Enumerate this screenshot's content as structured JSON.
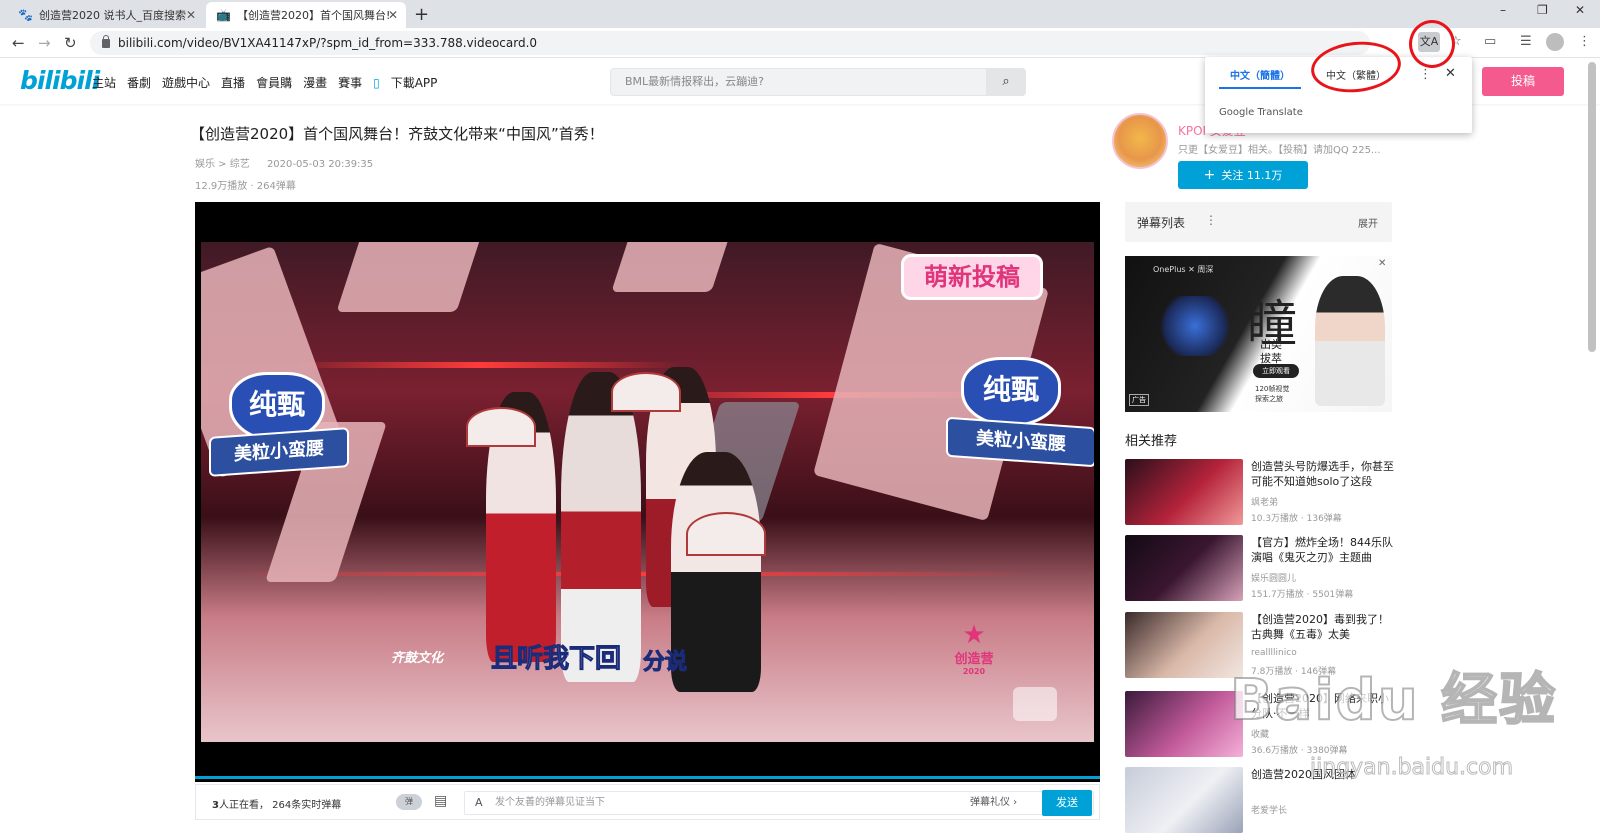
{
  "browser": {
    "tabs": [
      {
        "title": "创造营2020 说书人_百度搜索",
        "active": false
      },
      {
        "title": "【创造营2020】首个国风舞台!",
        "active": true
      }
    ],
    "url": "bilibili.com/video/BV1XA41147xP/?spm_id_from=333.788.videocard.0",
    "new_tab": "+",
    "window_controls": [
      "–",
      "❐",
      "✕"
    ]
  },
  "translate_popup": {
    "lang_active": "中文（簡體）",
    "lang_inactive": "中文（繁體）",
    "brand": "Google Translate",
    "accent": "#1a73e8"
  },
  "annotation_color": "#e8141a",
  "bili": {
    "logo": "bilibili",
    "brand_color": "#00a1d6",
    "nav": [
      "主站",
      "番劇",
      "遊戲中心",
      "直播",
      "會員購",
      "漫畫",
      "賽事",
      "下載APP"
    ],
    "search_placeholder": "BML最新情报释出，云蹦迪?",
    "upload": "投稿",
    "upload_color": "#f45a8d"
  },
  "video": {
    "title": "【创造营2020】首个国风舞台！齐鼓文化带来“中国风”首秀！",
    "category": "娱乐 > 综艺",
    "date": "2020-05-03 20:39:35",
    "stats": "12.9万播放 · 264弹幕",
    "overlay": {
      "sponsor_left_top": "纯甄",
      "sponsor_left_bottom": "美粒小蛮腰",
      "sponsor_right_top": "纯甄",
      "sponsor_right_bottom": "美粒小蛮腰",
      "badge": "萌新投稿",
      "subtitle_1": "且听我下回",
      "subtitle_2": "分说",
      "logo_left": "齐鼓文化",
      "show_logo": "创造营",
      "show_logo_year": "2020"
    }
  },
  "danmaku_bar": {
    "viewers_count": "3",
    "viewers_text": "人正在看，",
    "live_count": "264",
    "live_text": "条实时弹幕",
    "toggle": "弹",
    "placeholder": "发个友善的弹幕见证当下",
    "etiquette": "弹幕礼仪 ›",
    "send": "发送"
  },
  "up": {
    "name": "KPOP女爱豆",
    "desc": "只更【女爱豆】相关。【投稿】请加QQ 225...",
    "follow": "关注 11.1万"
  },
  "danmaku_list": {
    "label": "弹幕列表",
    "expand": "展开"
  },
  "ad": {
    "brand": "OnePlus ✕ 周深",
    "headline": "瞳",
    "sub1": "出类",
    "sub2": "拔萃",
    "cta": "立即观看",
    "footer1": "120帧视觉",
    "footer2": "探索之旅",
    "tag": "广告"
  },
  "related": {
    "heading": "相关推荐",
    "items": [
      {
        "title": "创造营头号防爆选手，你甚至可能不知道她solo了这段",
        "author": "飒老弟",
        "stats": "10.3万播放 · 136弹幕"
      },
      {
        "title": "【官方】燃炸全场！844乐队演唱《鬼灭之刃》主题曲",
        "author": "娱乐圆圆儿",
        "stats": "151.7万播放 · 5501弹幕"
      },
      {
        "title": "【创造营2020】毒到我了！古典舞《五毒》太美",
        "author": "reallllinico",
        "stats": "7.8万播放 · 146弹幕"
      },
      {
        "title": "【创造营2020】网络来职小分队·不一样",
        "author": "收藏",
        "stats": "36.6万播放 · 3380弹幕"
      },
      {
        "title": "创造营2020国风团体",
        "author": "老爱学长",
        "stats": ""
      }
    ]
  },
  "watermark": {
    "text": "Baidu 经验",
    "url": "jingyan.baidu.com"
  }
}
